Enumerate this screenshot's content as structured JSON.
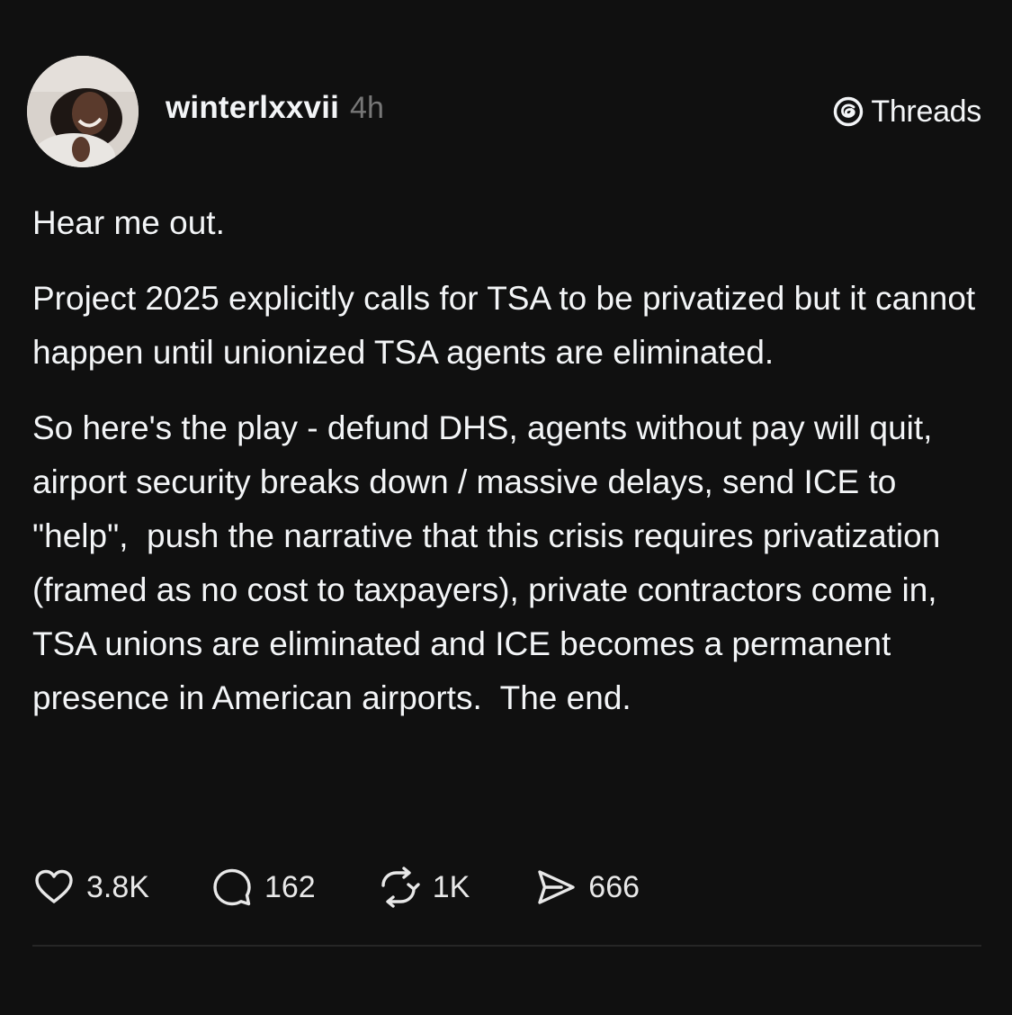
{
  "post": {
    "username": "winterlxxvii",
    "timestamp": "4h",
    "brand_icon": "threads-logo-icon",
    "brand_label": "Threads",
    "paragraphs": [
      "Hear me out.",
      "Project 2025 explicitly calls for TSA to be privatized but it cannot happen until unionized TSA agents are eliminated.",
      "So here's the play - defund DHS, agents without pay will quit, airport security breaks down / massive delays, send ICE to \"help\",  push the narrative that this crisis requires privatization (framed as no cost to taxpayers), private contractors come in, TSA unions are eliminated and ICE becomes a permanent presence in American airports.  The end."
    ]
  },
  "actions": {
    "like": {
      "icon": "heart-icon",
      "count": "3.8K"
    },
    "reply": {
      "icon": "comment-icon",
      "count": "162"
    },
    "repost": {
      "icon": "repost-icon",
      "count": "1K"
    },
    "share": {
      "icon": "send-icon",
      "count": "666"
    }
  },
  "colors": {
    "background": "#101010",
    "text": "#f3f5f7",
    "muted": "#777777",
    "divider": "#262626"
  }
}
